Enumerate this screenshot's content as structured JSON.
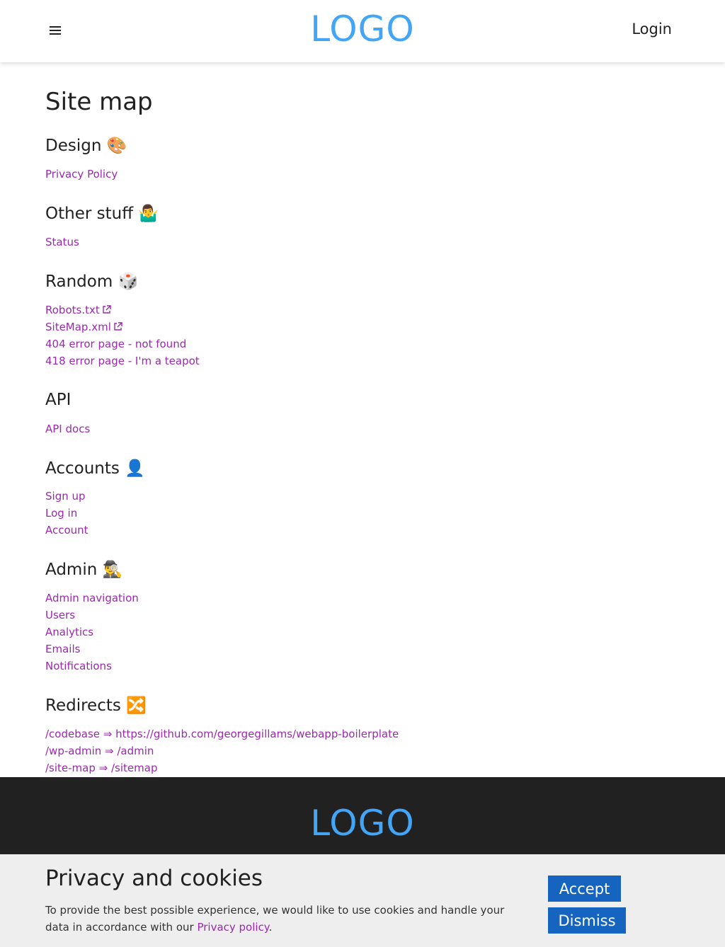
{
  "header": {
    "logo": "LOGO",
    "login": "Login"
  },
  "page": {
    "title": "Site map"
  },
  "sections": [
    {
      "heading": "Design 🎨",
      "links": [
        {
          "label": "Privacy Policy"
        }
      ]
    },
    {
      "heading": "Other stuff 🤷‍♂️",
      "links": [
        {
          "label": "Status"
        }
      ]
    },
    {
      "heading": "Random 🎲",
      "links": [
        {
          "label": "Robots.txt",
          "external": true
        },
        {
          "label": "SiteMap.xml",
          "external": true
        },
        {
          "label": "404 error page - not found"
        },
        {
          "label": "418 error page - I'm a teapot"
        }
      ]
    },
    {
      "heading": "API",
      "links": [
        {
          "label": "API docs"
        }
      ]
    },
    {
      "heading": "Accounts 👤",
      "links": [
        {
          "label": "Sign up"
        },
        {
          "label": "Log in"
        },
        {
          "label": "Account"
        }
      ]
    },
    {
      "heading": "Admin 🕵️‍♂️",
      "links": [
        {
          "label": "Admin navigation"
        },
        {
          "label": "Users"
        },
        {
          "label": "Analytics"
        },
        {
          "label": "Emails"
        },
        {
          "label": "Notifications"
        }
      ]
    },
    {
      "heading": "Redirects 🔀",
      "links": [
        {
          "label": "/codebase ⇒ https://github.com/georgegillams/webapp-boilerplate"
        },
        {
          "label": "/wp-admin ⇒ /admin"
        },
        {
          "label": "/site-map ⇒ /sitemap"
        }
      ]
    }
  ],
  "footer": {
    "logo": "LOGO"
  },
  "cookie": {
    "title": "Privacy and cookies",
    "text_before": "To provide the best possible experience, we would like to use cookies and handle your data in accordance with our ",
    "link": "Privacy policy",
    "text_after": ".",
    "accept": "Accept",
    "dismiss": "Dismiss"
  },
  "colors": {
    "logo": "#42a5f5",
    "link": "#9c27b0",
    "button": "#1565c0",
    "footer": "#212121",
    "banner": "#eeeeee"
  },
  "icons": {
    "menu": "hamburger-menu-icon",
    "external": "external-link-icon"
  }
}
